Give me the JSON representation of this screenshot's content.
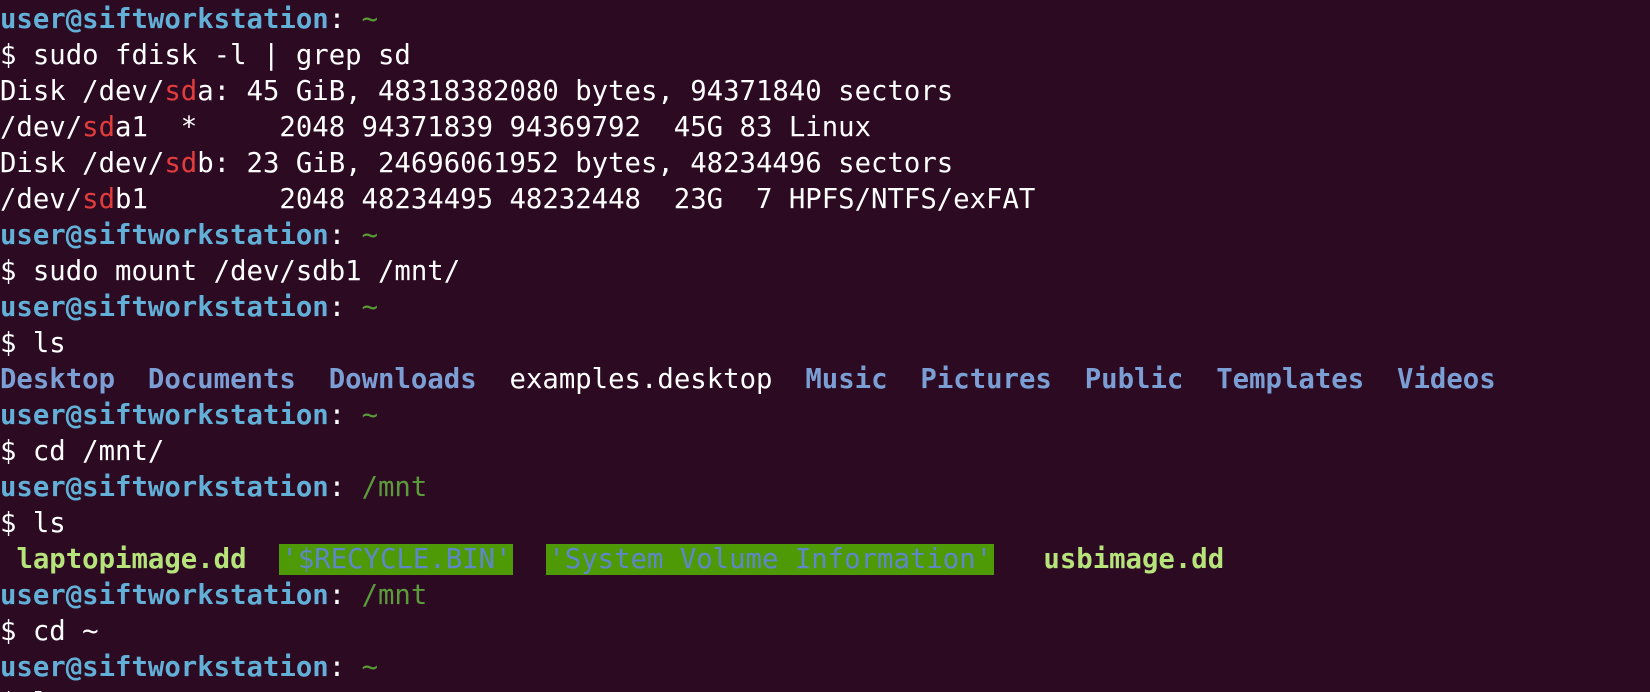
{
  "prompt": {
    "user_host": "user@siftworkstation",
    "colon": ":",
    "dollar": "$"
  },
  "lines": [
    {
      "kind": "prompt",
      "path": "~"
    },
    {
      "kind": "cmd",
      "text": "sudo fdisk -l | grep sd"
    },
    {
      "kind": "out_hl",
      "before": "Disk /dev/",
      "hl": "sd",
      "after": "a: 45 GiB, 48318382080 bytes, 94371840 sectors"
    },
    {
      "kind": "out_hl",
      "before": "/dev/",
      "hl": "sd",
      "after": "a1  *     2048 94371839 94369792  45G 83 Linux"
    },
    {
      "kind": "out_hl",
      "before": "Disk /dev/",
      "hl": "sd",
      "after": "b: 23 GiB, 24696061952 bytes, 48234496 sectors"
    },
    {
      "kind": "out_hl",
      "before": "/dev/",
      "hl": "sd",
      "after": "b1        2048 48234495 48232448  23G  7 HPFS/NTFS/exFAT"
    },
    {
      "kind": "prompt",
      "path": "~"
    },
    {
      "kind": "cmd",
      "text": "sudo mount /dev/sdb1 /mnt/"
    },
    {
      "kind": "prompt",
      "path": "~"
    },
    {
      "kind": "cmd",
      "text": "ls"
    },
    {
      "kind": "ls_home",
      "items": [
        {
          "name": "Desktop",
          "type": "dir"
        },
        {
          "name": "Documents",
          "type": "dir"
        },
        {
          "name": "Downloads",
          "type": "dir"
        },
        {
          "name": "examples.desktop",
          "type": "file"
        },
        {
          "name": "Music",
          "type": "dir"
        },
        {
          "name": "Pictures",
          "type": "dir"
        },
        {
          "name": "Public",
          "type": "dir"
        },
        {
          "name": "Templates",
          "type": "dir"
        },
        {
          "name": "Videos",
          "type": "dir"
        }
      ]
    },
    {
      "kind": "prompt",
      "path": "~"
    },
    {
      "kind": "cmd",
      "text": "cd /mnt/"
    },
    {
      "kind": "prompt",
      "path": "/mnt"
    },
    {
      "kind": "cmd",
      "text": "ls"
    },
    {
      "kind": "ls_mnt",
      "items": [
        {
          "name": "laptopimage.dd",
          "type": "exec"
        },
        {
          "name": "'$RECYCLE.BIN'",
          "type": "other_writable"
        },
        {
          "name": "'System Volume Information'",
          "type": "other_writable"
        },
        {
          "name": "usbimage.dd",
          "type": "exec"
        }
      ]
    },
    {
      "kind": "prompt",
      "path": "/mnt"
    },
    {
      "kind": "cmd",
      "text": "cd ~"
    },
    {
      "kind": "prompt",
      "path": "~"
    },
    {
      "kind": "cmd",
      "text": "ls"
    }
  ],
  "colors": {
    "background": "#2c0b22",
    "prompt_user": "#62b0d8",
    "prompt_path": "#5a9c3a",
    "highlight": "#e23c3c",
    "directory": "#7b9fd4",
    "executable": "#b6e37a",
    "other_writable_bg": "#4e9a06"
  }
}
